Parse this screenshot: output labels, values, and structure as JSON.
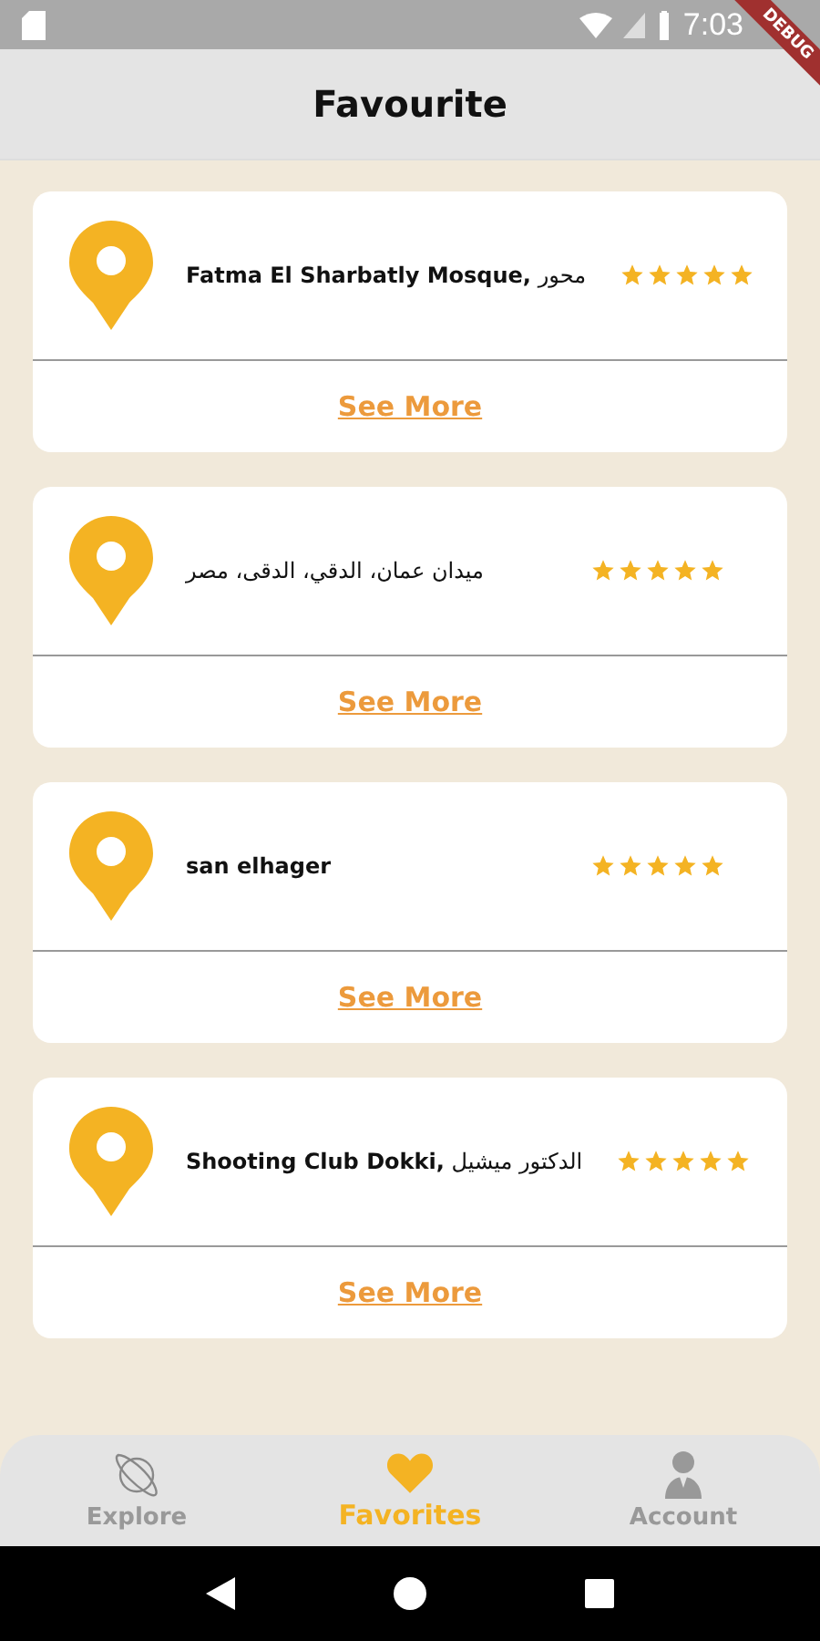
{
  "status_bar": {
    "time": "7:03"
  },
  "debug_banner": "DEBUG",
  "app_bar": {
    "title": "Favourite"
  },
  "places": [
    {
      "name": "Fatma El Sharbatly Mosque,",
      "address": "محور",
      "stars": 5,
      "action": "See More"
    },
    {
      "address": "ميدان عمان، الدقي، الدقى، مصر",
      "stars": 5,
      "action": "See More"
    },
    {
      "name": "san elhager",
      "stars": 5,
      "action": "See More"
    },
    {
      "name": "Shooting Club Dokki,",
      "address": "الدكتور ميشيل",
      "stars": 5,
      "action": "See More"
    }
  ],
  "bottom_nav": [
    {
      "kind": "explore",
      "label": "Explore",
      "selected": false
    },
    {
      "kind": "favorites",
      "label": "Favorites",
      "selected": true
    },
    {
      "kind": "account",
      "label": "Account",
      "selected": false
    }
  ]
}
